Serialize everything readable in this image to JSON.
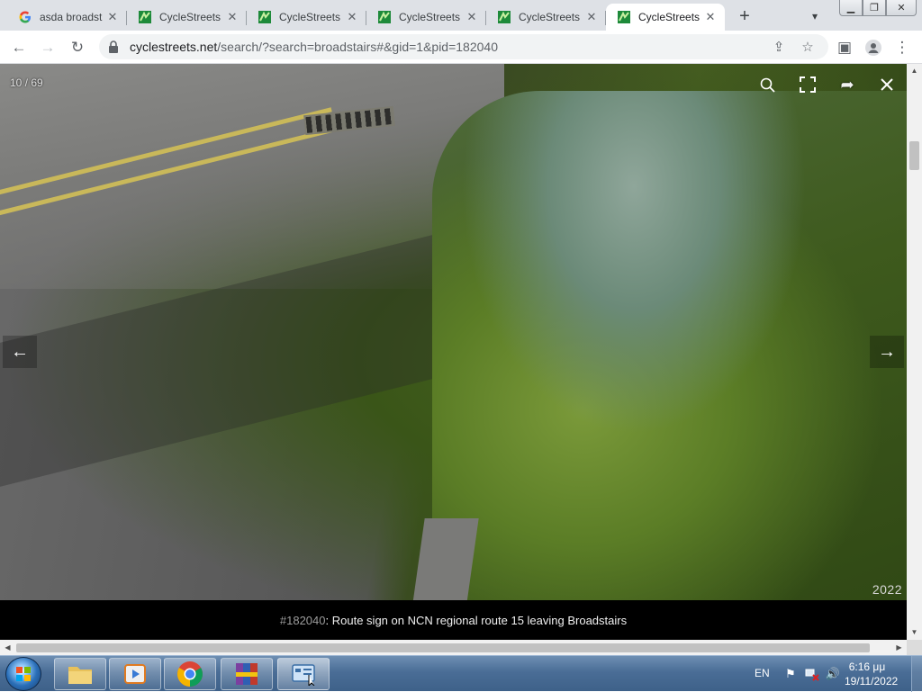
{
  "browser": {
    "tabs": [
      {
        "title": "asda broadst",
        "favicon": "google-g-icon",
        "active": false
      },
      {
        "title": "CycleStreets",
        "favicon": "cyclestreets-icon",
        "active": false
      },
      {
        "title": "CycleStreets",
        "favicon": "cyclestreets-icon",
        "active": false
      },
      {
        "title": "CycleStreets",
        "favicon": "cyclestreets-icon",
        "active": false
      },
      {
        "title": "CycleStreets",
        "favicon": "cyclestreets-icon",
        "active": false
      },
      {
        "title": "CycleStreets",
        "favicon": "cyclestreets-icon",
        "active": true
      }
    ],
    "address": {
      "host": "cyclestreets.net",
      "path": "/search/?search=broadstairs#&gid=1&pid=182040"
    },
    "accent_favicon_color": "#1e8a3a"
  },
  "viewer": {
    "counter": "10 / 69",
    "year": "2022",
    "caption": {
      "id": "#182040",
      "separator": ": ",
      "text": "Route sign on NCN regional route 15 leaving Broadstairs"
    }
  },
  "taskbar": {
    "language": "EN",
    "time": "6:16 μμ",
    "date": "19/11/2022",
    "apps": [
      "file-explorer-icon",
      "media-player-icon",
      "chrome-icon",
      "winrar-icon",
      "network-app-icon"
    ]
  }
}
